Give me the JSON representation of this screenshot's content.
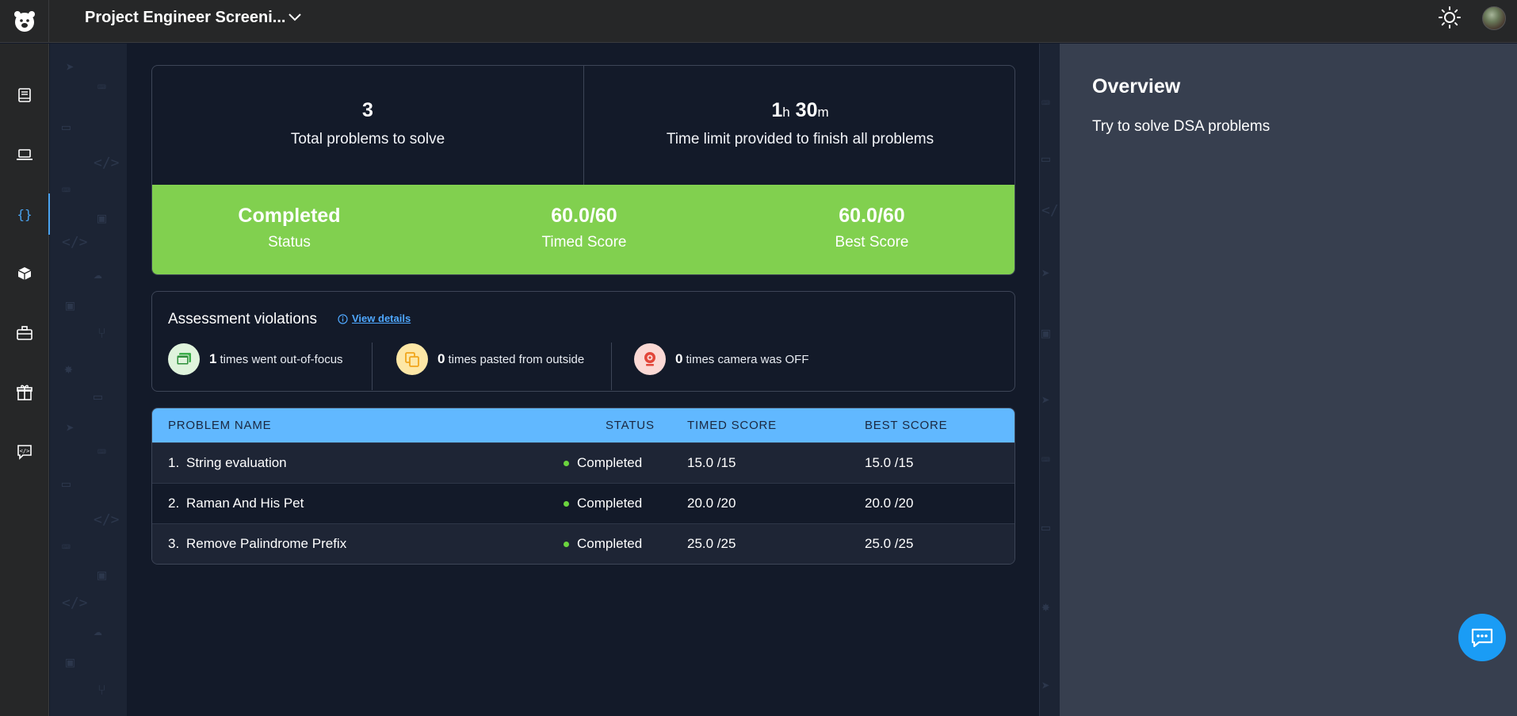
{
  "header": {
    "project_title": "Project Engineer Screeni...",
    "icons": [
      "bear-logo-icon",
      "chevron-down-icon",
      "sun-icon",
      "avatar"
    ]
  },
  "sidebar": {
    "items": [
      {
        "icon": "book-icon"
      },
      {
        "icon": "laptop-icon"
      },
      {
        "icon": "code-braces-icon",
        "active": true
      },
      {
        "icon": "cube-icon"
      },
      {
        "icon": "briefcase-icon"
      },
      {
        "icon": "gift-icon"
      },
      {
        "icon": "feedback-icon"
      }
    ]
  },
  "stats": {
    "total_problems": "3",
    "total_problems_label": "Total problems to solve",
    "time_hours": "1",
    "time_hours_unit": "h",
    "time_minutes": "30",
    "time_minutes_unit": "m",
    "time_label": "Time limit provided to finish all problems",
    "status_value": "Completed",
    "status_label": "Status",
    "timed_score_value": "60.0/60",
    "timed_score_label": "Timed Score",
    "best_score_value": "60.0/60",
    "best_score_label": "Best Score"
  },
  "violations": {
    "title": "Assessment violations",
    "link": "View details",
    "items": [
      {
        "count": "1",
        "text": "times went out-of-focus",
        "icon": "window-icon"
      },
      {
        "count": "0",
        "text": "times pasted from outside",
        "icon": "paste-icon"
      },
      {
        "count": "0",
        "text": "times camera was OFF",
        "icon": "webcam-icon"
      }
    ]
  },
  "table": {
    "headers": [
      "PROBLEM NAME",
      "STATUS",
      "TIMED SCORE",
      "BEST SCORE"
    ],
    "rows": [
      {
        "index": "1.",
        "name": "String evaluation",
        "status": "Completed",
        "timed": "15.0 /15",
        "best": "15.0 /15"
      },
      {
        "index": "2.",
        "name": "Raman And His Pet",
        "status": "Completed",
        "timed": "20.0 /20",
        "best": "20.0 /20"
      },
      {
        "index": "3.",
        "name": "Remove Palindrome Prefix",
        "status": "Completed",
        "timed": "25.0 /25",
        "best": "25.0 /25"
      }
    ]
  },
  "overview": {
    "title": "Overview",
    "description": "Try to solve DSA problems"
  },
  "colors": {
    "accent": "#4aa3f0",
    "success_green": "#81d04f",
    "table_header": "#61b8ff",
    "chat_fab": "#1a9cf5"
  }
}
